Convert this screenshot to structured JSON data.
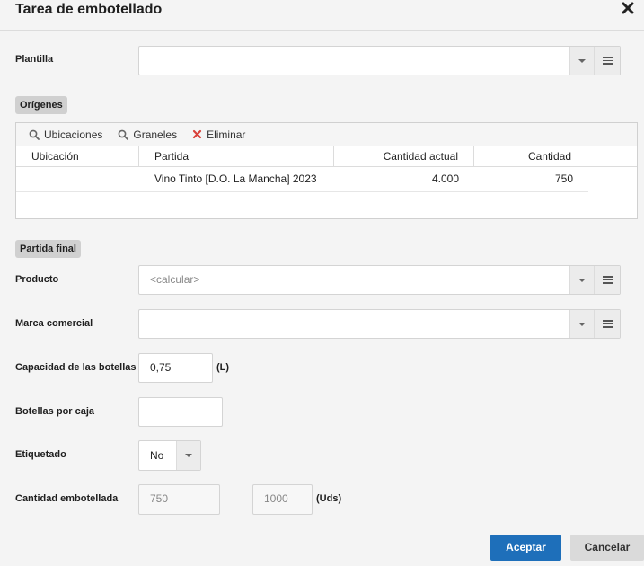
{
  "dialog": {
    "title": "Tarea de embotellado"
  },
  "plantilla": {
    "label": "Plantilla",
    "value": ""
  },
  "origenes": {
    "section_label": "Orígenes",
    "toolbar": {
      "ubicaciones": "Ubicaciones",
      "graneles": "Graneles",
      "eliminar": "Eliminar"
    },
    "columns": [
      "Ubicación",
      "Partida",
      "Cantidad actual",
      "Cantidad"
    ],
    "rows": [
      {
        "ubicacion": "",
        "partida": "Vino Tinto [D.O.  La Mancha] 2023",
        "cantidad_actual": "4.000",
        "cantidad": "750"
      }
    ]
  },
  "partida_final": {
    "section_label": "Partida final",
    "producto": {
      "label": "Producto",
      "placeholder": "<calcular>"
    },
    "marca": {
      "label": "Marca comercial",
      "value": ""
    },
    "capacidad": {
      "label": "Capacidad de las botellas",
      "value": "0,75",
      "unit": "(L)"
    },
    "botellas_caja": {
      "label": "Botellas por caja",
      "value": ""
    },
    "etiquetado": {
      "label": "Etiquetado",
      "value": "No"
    },
    "cantidad": {
      "label": "Cantidad embotellada",
      "value_1": "750",
      "value_2": "1000",
      "unit": "(Uds)"
    }
  },
  "footer": {
    "accept": "Aceptar",
    "cancel": "Cancelar"
  },
  "colors": {
    "primary": "#1e6fba",
    "delete": "#d9413a"
  }
}
